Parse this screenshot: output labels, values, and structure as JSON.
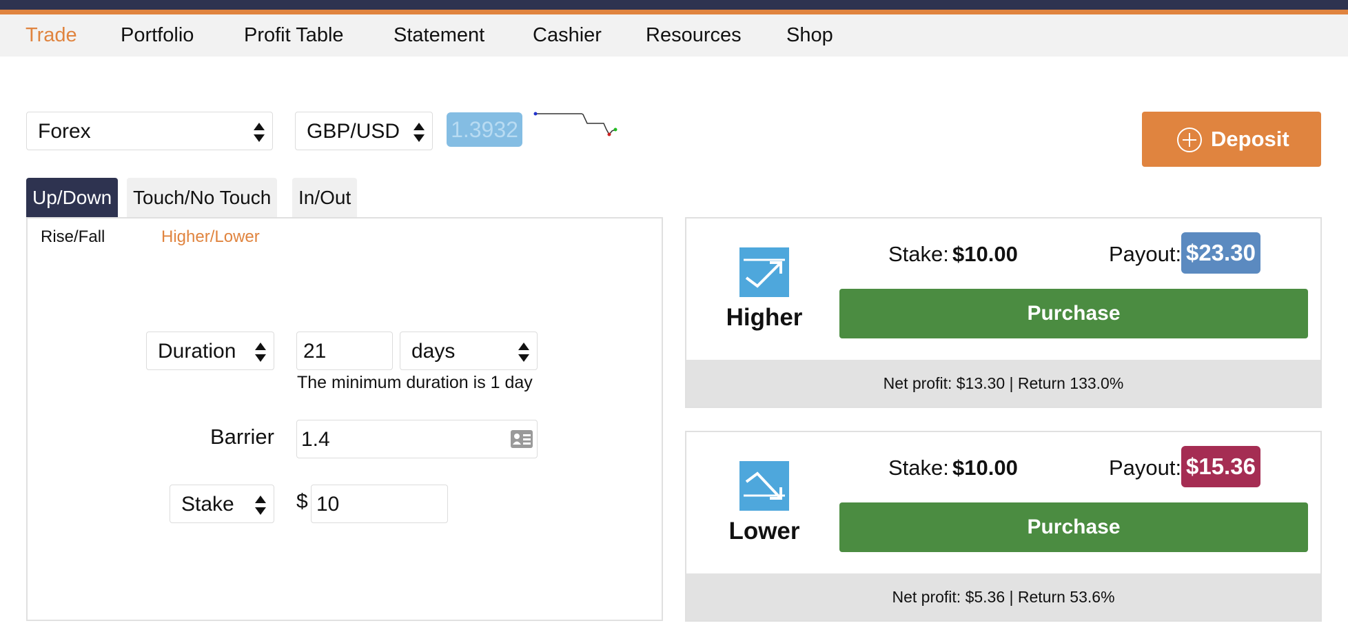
{
  "nav": {
    "items": [
      {
        "label": "Trade",
        "active": true
      },
      {
        "label": "Portfolio"
      },
      {
        "label": "Profit Table"
      },
      {
        "label": "Statement"
      },
      {
        "label": "Cashier"
      },
      {
        "label": "Resources"
      },
      {
        "label": "Shop"
      }
    ]
  },
  "market": {
    "category": "Forex",
    "symbol": "GBP/USD",
    "spot_price": "1.3932"
  },
  "deposit": {
    "label": "Deposit"
  },
  "tabs": [
    "Up/Down",
    "Touch/No Touch",
    "In/Out"
  ],
  "subtabs": [
    "Rise/Fall",
    "Higher/Lower"
  ],
  "form": {
    "duration_select": "Duration",
    "duration_value": "21",
    "duration_unit": "days",
    "duration_hint": "The minimum duration is 1 day",
    "barrier_label": "Barrier",
    "barrier_value": "1.4",
    "stake_select": "Stake",
    "currency_symbol": "$",
    "stake_value": "10"
  },
  "contracts": [
    {
      "name": "Higher",
      "stake_label": "Stake:",
      "stake_amount": "$10.00",
      "payout_label": "Payout:",
      "payout_amount": "$23.30",
      "purchase_label": "Purchase",
      "footer": "Net profit: $13.30 | Return 133.0%",
      "payout_color": "#5b8ac0"
    },
    {
      "name": "Lower",
      "stake_label": "Stake:",
      "stake_amount": "$10.00",
      "payout_label": "Payout:",
      "payout_amount": "$15.36",
      "purchase_label": "Purchase",
      "footer": "Net profit: $5.36 | Return 53.6%",
      "payout_color": "#a52d53"
    }
  ],
  "colors": {
    "accent": "#e0843f",
    "navy": "#2e3350",
    "purchase_green": "#4b8c41",
    "icon_blue": "#4ea7dc"
  }
}
